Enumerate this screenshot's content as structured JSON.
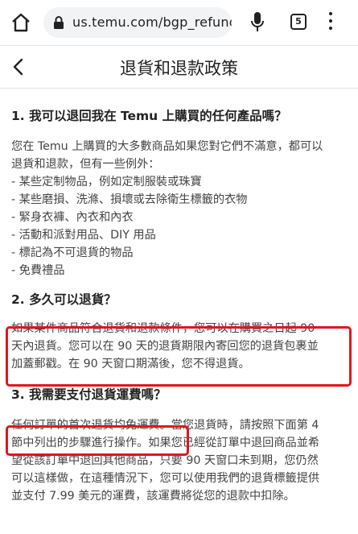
{
  "browser": {
    "url": "us.temu.com/bgp_refund",
    "tab_count": "5"
  },
  "page": {
    "title": "退貨和退款政策"
  },
  "sections": [
    {
      "question": "1. 我可以退回我在 Temu 上購買的任何產品嗎？",
      "answer_lines": [
        "您在 Temu 上購買的大多數商品如果您對它們不滿意，都可以",
        "退貨和退款，但有一些例外："
      ],
      "exceptions": [
        "- 某些定制物品，例如定制服裝或珠寶",
        "- 某些磨損、洗滌、損壞或去除衛生標籤的衣物",
        "- 緊身衣褲、內衣和內衣",
        "- 活動和派對用品、DIY 用品",
        "- 標記為不可退貨的物品",
        "- 免費禮品"
      ]
    },
    {
      "question": "2. 多久可以退貨？",
      "answer_lines": [
        "如果某件商品符合退貨和退款條件，您可以在購買之日起 90",
        "天內退貨。您可以在 90 天的退貨期限內寄回您的退貨包裹並",
        "加蓋郵戳。在 90 天窗口期滿後，您不得退貨。"
      ]
    },
    {
      "question": "3. 我需要支付退貨運費嗎？",
      "answer_lines": [
        "任何訂單的首次退貨均免運費。當您退貨時，請按照下面第 4",
        "節中列出的步驟進行操作。如果您已經從訂單中退回商品並希",
        "望從該訂單中退回其他商品，只要 90 天窗口未到期，您仍然",
        "可以這樣做，在這種情況下，您可以使用我們的退貨標籤提供",
        "並支付 7.99 美元的運費，該運費將從您的退款中扣除。"
      ]
    }
  ],
  "colors": {
    "highlight_box": "#e0161e",
    "text": "#444444",
    "heading": "#222222"
  }
}
